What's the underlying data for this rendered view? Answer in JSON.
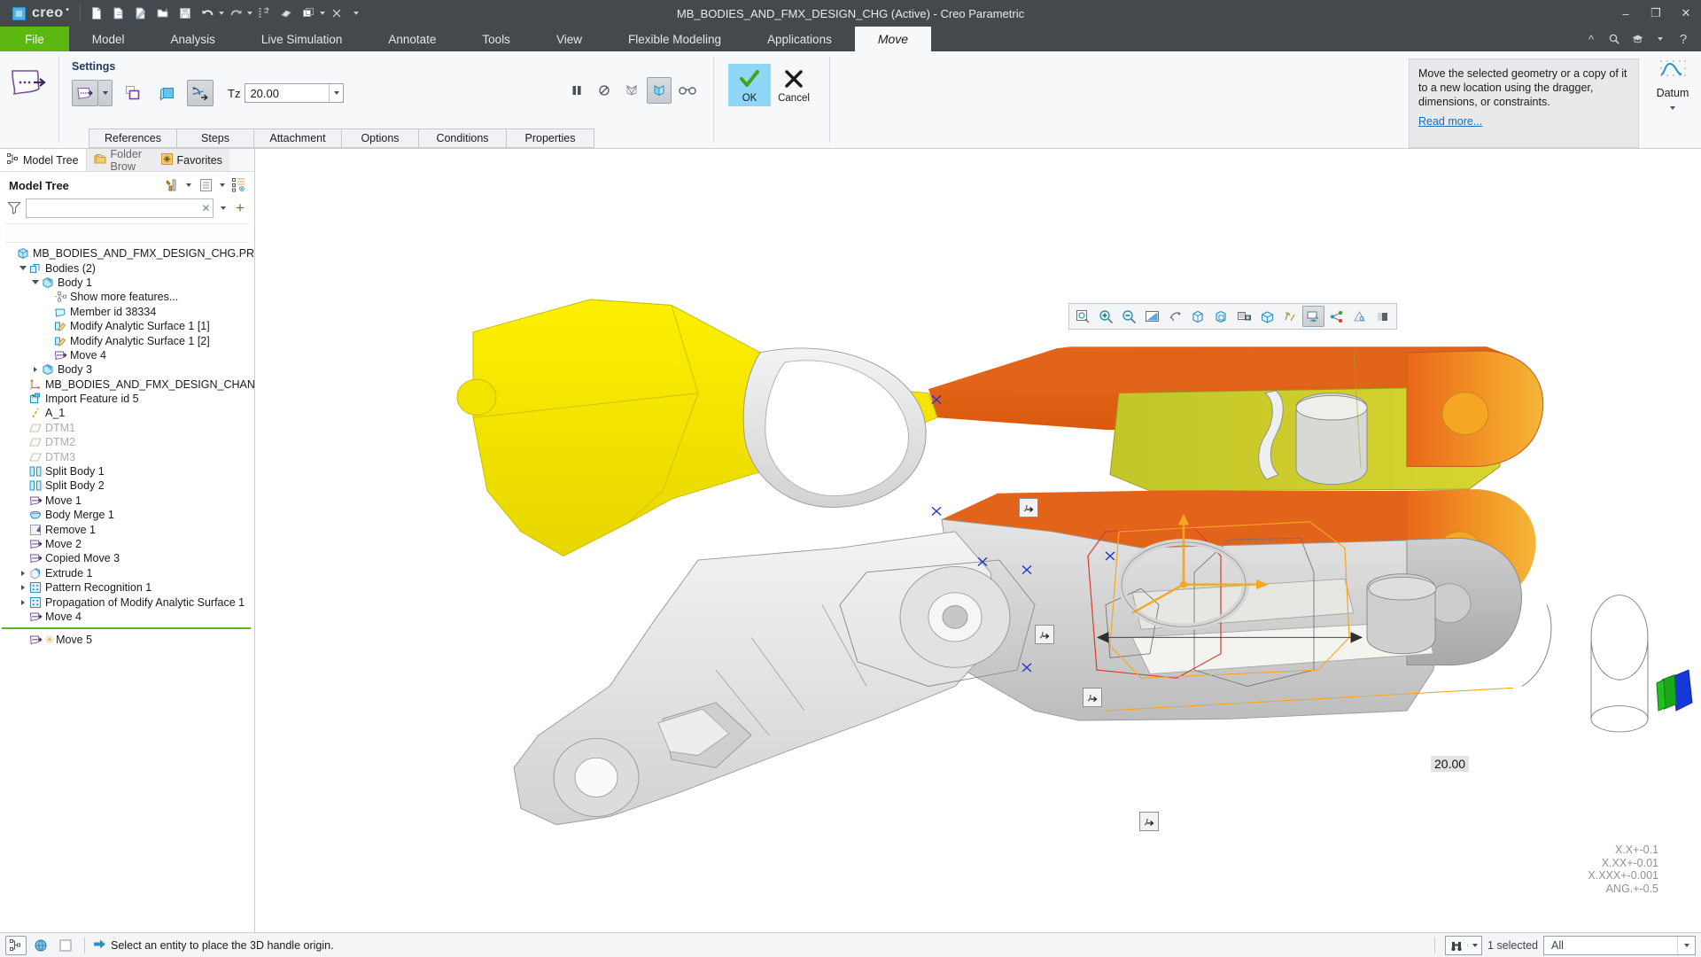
{
  "titlebar": {
    "brand": "creo",
    "title": "MB_BODIES_AND_FMX_DESIGN_CHG (Active) - Creo Parametric",
    "quick_access": [
      {
        "name": "new-file-icon",
        "label": "New"
      },
      {
        "name": "open-file-icon",
        "label": "Open"
      },
      {
        "name": "save-as-icon",
        "label": "Save As"
      },
      {
        "name": "open-folder-icon",
        "label": "Open Folder"
      },
      {
        "name": "save-icon",
        "label": "Save"
      },
      {
        "name": "undo-icon",
        "label": "Undo"
      },
      {
        "name": "redo-icon",
        "label": "Redo"
      },
      {
        "name": "regenerate-icon",
        "label": "Regenerate"
      },
      {
        "name": "erase-icon",
        "label": "Erase"
      },
      {
        "name": "window-icon",
        "label": "Window"
      },
      {
        "name": "close-window-icon",
        "label": "Close"
      }
    ],
    "window_buttons": [
      "minimize",
      "restore",
      "close"
    ]
  },
  "ribbon": {
    "tabs": [
      {
        "label": "File",
        "kind": "file"
      },
      {
        "label": "Model",
        "kind": "normal"
      },
      {
        "label": "Analysis",
        "kind": "normal"
      },
      {
        "label": "Live Simulation",
        "kind": "normal"
      },
      {
        "label": "Annotate",
        "kind": "normal"
      },
      {
        "label": "Tools",
        "kind": "normal"
      },
      {
        "label": "View",
        "kind": "normal"
      },
      {
        "label": "Flexible Modeling",
        "kind": "normal"
      },
      {
        "label": "Applications",
        "kind": "normal"
      },
      {
        "label": "Move",
        "kind": "active"
      }
    ],
    "right_icons": [
      "collapse-ribbon-icon",
      "search-icon",
      "learning-icon",
      "dropdown-icon",
      "help-icon"
    ],
    "settings_group_label": "Settings",
    "tz_label": "Tz",
    "tz_value": "20.00",
    "dashboard_tabs": [
      "References",
      "Steps",
      "Attachment",
      "Options",
      "Conditions",
      "Properties"
    ],
    "toolbar_icons": [
      "pause-icon",
      "no-preview-icon",
      "geometry-preview-icon",
      "preview-icon",
      "glasses-icon"
    ],
    "ok_label": "OK",
    "cancel_label": "Cancel",
    "help": {
      "text": "Move the selected geometry or a copy of it to a new location using the dragger, dimensions, or constraints.",
      "link": "Read more..."
    },
    "datum_label": "Datum"
  },
  "left_panel": {
    "nav_tabs": [
      {
        "label": "Model Tree",
        "icon": "model-tree-icon",
        "active": true
      },
      {
        "label": "Folder Brow",
        "icon": "folder-browser-icon",
        "active": false
      },
      {
        "label": "Favorites",
        "icon": "favorites-icon",
        "active": false
      }
    ],
    "panel_title": "Model Tree",
    "tools": [
      "settings-icon",
      "tools-dropdown-icon",
      "display-icon",
      "display-dropdown-icon",
      "tree-filters-icon"
    ],
    "filter": {
      "value": "",
      "placeholder": ""
    },
    "tree": [
      {
        "label": "MB_BODIES_AND_FMX_DESIGN_CHG.PRT",
        "depth": 0,
        "icon": "part-icon",
        "twisty": "none"
      },
      {
        "label": "Bodies (2)",
        "depth": 1,
        "icon": "bodies-icon",
        "twisty": "open"
      },
      {
        "label": "Body 1",
        "depth": 2,
        "icon": "body-icon",
        "twisty": "open"
      },
      {
        "label": "Show more features...",
        "depth": 3,
        "icon": "show-more-icon",
        "twisty": "none"
      },
      {
        "label": "Member id 38334",
        "depth": 3,
        "icon": "member-icon",
        "twisty": "none"
      },
      {
        "label": "Modify Analytic Surface 1 [1]",
        "depth": 3,
        "icon": "modify-surface-icon",
        "twisty": "none"
      },
      {
        "label": "Modify Analytic Surface 1 [2]",
        "depth": 3,
        "icon": "modify-surface-icon",
        "twisty": "none"
      },
      {
        "label": "Move 4",
        "depth": 3,
        "icon": "move-icon",
        "twisty": "none"
      },
      {
        "label": "Body 3",
        "depth": 2,
        "icon": "body-icon",
        "twisty": "closed"
      },
      {
        "label": "MB_BODIES_AND_FMX_DESIGN_CHANGE",
        "depth": 1,
        "icon": "coordinate-system-icon",
        "twisty": "none"
      },
      {
        "label": "Import Feature id 5",
        "depth": 1,
        "icon": "import-feature-icon",
        "twisty": "none"
      },
      {
        "label": "A_1",
        "depth": 1,
        "icon": "axis-icon",
        "twisty": "none"
      },
      {
        "label": "DTM1",
        "depth": 1,
        "icon": "datum-plane-icon",
        "twisty": "none",
        "dim": true
      },
      {
        "label": "DTM2",
        "depth": 1,
        "icon": "datum-plane-icon",
        "twisty": "none",
        "dim": true
      },
      {
        "label": "DTM3",
        "depth": 1,
        "icon": "datum-plane-icon",
        "twisty": "none",
        "dim": true
      },
      {
        "label": "Split Body 1",
        "depth": 1,
        "icon": "split-body-icon",
        "twisty": "none"
      },
      {
        "label": "Split Body 2",
        "depth": 1,
        "icon": "split-body-icon",
        "twisty": "none"
      },
      {
        "label": "Move 1",
        "depth": 1,
        "icon": "move-icon",
        "twisty": "none"
      },
      {
        "label": "Body Merge 1",
        "depth": 1,
        "icon": "body-merge-icon",
        "twisty": "none"
      },
      {
        "label": "Remove 1",
        "depth": 1,
        "icon": "remove-icon",
        "twisty": "none"
      },
      {
        "label": "Move 2",
        "depth": 1,
        "icon": "move-icon",
        "twisty": "none"
      },
      {
        "label": "Copied Move 3",
        "depth": 1,
        "icon": "move-icon",
        "twisty": "none"
      },
      {
        "label": "Extrude 1",
        "depth": 1,
        "icon": "extrude-icon",
        "twisty": "closed"
      },
      {
        "label": "Pattern Recognition 1",
        "depth": 1,
        "icon": "pattern-icon",
        "twisty": "closed"
      },
      {
        "label": "Propagation of Modify Analytic Surface 1",
        "depth": 1,
        "icon": "pattern-icon",
        "twisty": "closed"
      },
      {
        "label": "Move 4",
        "depth": 1,
        "icon": "move-icon",
        "twisty": "none"
      }
    ],
    "insert_indicator": true,
    "tree_after_indicator": [
      {
        "label": "Move 5",
        "depth": 1,
        "icon": "move-icon",
        "twisty": "none",
        "star": true
      }
    ]
  },
  "viewport": {
    "graphics_toolbar": [
      "refit-icon",
      "zoom-in-icon",
      "zoom-out-icon",
      "repaint-icon",
      "spin-center-icon",
      "display-style-icon",
      "saved-orientations-icon",
      "scene-capture-icon",
      "perspective-icon",
      "datum-display-icon",
      "annotation-display-icon",
      "layer-icon",
      "appearance-icon",
      "view-manager-icon"
    ],
    "dimension_label": "20.00",
    "tolerance_lines": [
      "X.X+-0.1",
      "X.XX+-0.01",
      "X.XXX+-0.001",
      "ANG.+-0.5"
    ],
    "handle_tags": 5
  },
  "statusbar": {
    "left_icons": [
      "model-tree-toggle-icon",
      "browser-icon",
      "panel-icon"
    ],
    "message_icon": "arrow-right-icon",
    "message": "Select an entity to place the 3D handle origin.",
    "find_icon": "binoculars-icon",
    "selection_count": "1 selected",
    "filter_value": "All"
  },
  "colors": {
    "titlebar_bg": "#43494d",
    "file_tab_green": "#5cb811",
    "accent_blue": "#8fd6f7",
    "link_blue": "#1a6bbd",
    "insert_green": "#57b81a",
    "body_yellow": "#f5e500",
    "body_orange": "#e2641b",
    "body_olive": "#b5bb2a",
    "body_gray": "#bfbfbf",
    "dragger_orange": "#f5a623"
  }
}
